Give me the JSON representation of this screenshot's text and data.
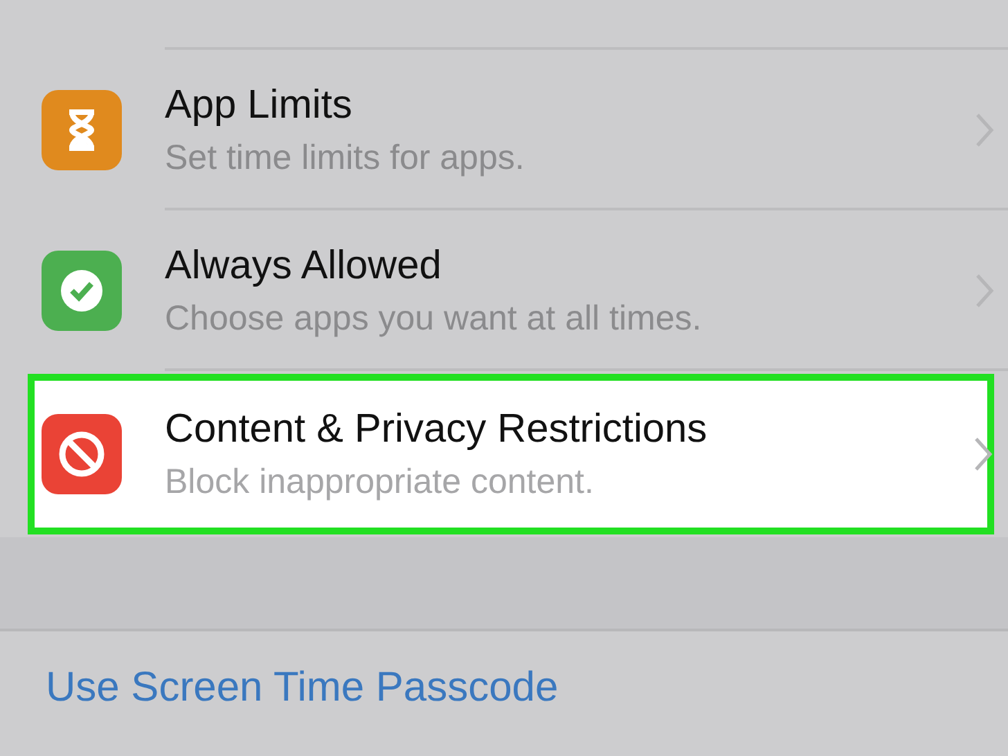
{
  "settings_rows": [
    {
      "title": "App Limits",
      "subtitle": "Set time limits for apps.",
      "color": "#e08a1e",
      "highlighted": false
    },
    {
      "title": "Always Allowed",
      "subtitle": "Choose apps you want at all times.",
      "color": "#4caf50",
      "highlighted": false
    },
    {
      "title": "Content & Privacy Restrictions",
      "subtitle": "Block inappropriate content.",
      "color": "#ea4336",
      "highlighted": true
    }
  ],
  "passcode_link": "Use Screen Time Passcode"
}
